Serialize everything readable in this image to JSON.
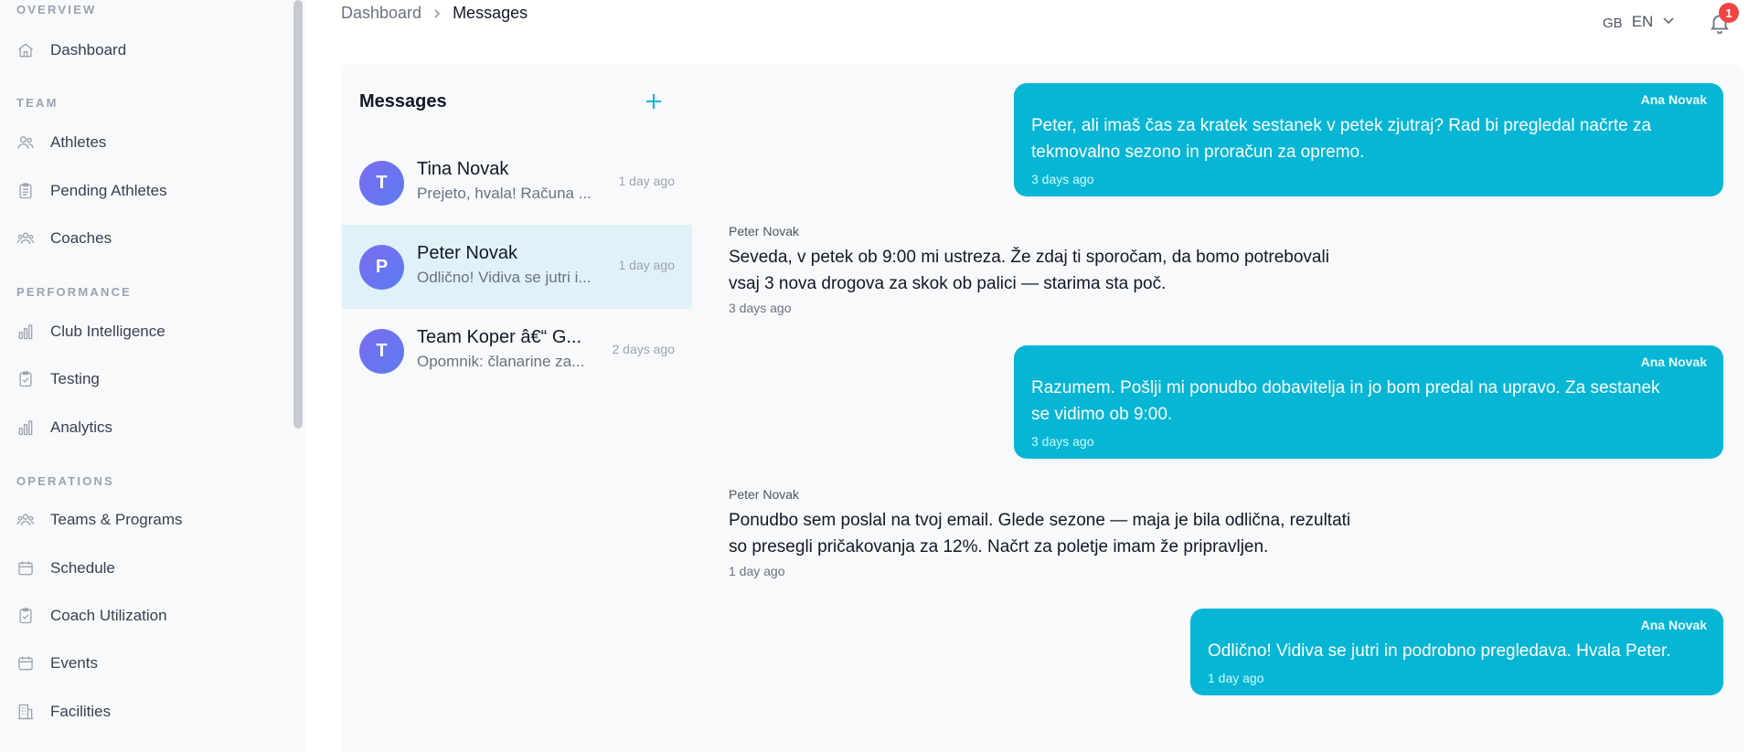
{
  "sidebar": {
    "sections": [
      {
        "title": "OVERVIEW",
        "items": [
          {
            "label": "Dashboard",
            "icon": "home-icon"
          }
        ]
      },
      {
        "title": "TEAM",
        "items": [
          {
            "label": "Athletes",
            "icon": "users-icon"
          },
          {
            "label": "Pending Athletes",
            "icon": "clipboard-icon"
          },
          {
            "label": "Coaches",
            "icon": "users-group-icon"
          }
        ]
      },
      {
        "title": "PERFORMANCE",
        "items": [
          {
            "label": "Club Intelligence",
            "icon": "bar-chart-icon"
          },
          {
            "label": "Testing",
            "icon": "clipboard-check-icon"
          },
          {
            "label": "Analytics",
            "icon": "bar-chart-icon"
          }
        ]
      },
      {
        "title": "OPERATIONS",
        "items": [
          {
            "label": "Teams & Programs",
            "icon": "users-group-icon"
          },
          {
            "label": "Schedule",
            "icon": "calendar-icon"
          },
          {
            "label": "Coach Utilization",
            "icon": "clipboard-check-icon"
          },
          {
            "label": "Events",
            "icon": "calendar-icon"
          },
          {
            "label": "Facilities",
            "icon": "building-icon"
          }
        ]
      }
    ]
  },
  "header": {
    "breadcrumb": {
      "parent": "Dashboard",
      "current": "Messages"
    },
    "language": {
      "flag": "GB",
      "code": "EN"
    },
    "notifications": {
      "count": "1"
    }
  },
  "conversations": {
    "title": "Messages",
    "items": [
      {
        "initial": "T",
        "name": "Tina Novak",
        "preview": "Prejeto, hvala! Računa ...",
        "time": "1 day ago",
        "active": false
      },
      {
        "initial": "P",
        "name": "Peter Novak",
        "preview": "Odlično! Vidiva se jutri i...",
        "time": "1 day ago",
        "active": true
      },
      {
        "initial": "T",
        "name": "Team Koper â€“ G...",
        "preview": "Opomnik: članarine za...",
        "time": "2 days ago",
        "active": false
      }
    ]
  },
  "messages": [
    {
      "direction": "out",
      "sender": "Ana Novak",
      "lines": [
        "Peter, ali imaš čas za kratek sestanek v petek zjutraj? Rad bi pregledal načrte za",
        "tekmovalno sezono in proračun za opremo."
      ],
      "time": "3 days ago"
    },
    {
      "direction": "in",
      "sender": "Peter Novak",
      "lines": [
        "Seveda, v petek ob 9:00 mi ustreza. Že zdaj ti sporočam, da bomo potrebovali",
        "vsaj 3 nova drogova za skok ob palici — starima sta poč."
      ],
      "time": "3 days ago"
    },
    {
      "direction": "out",
      "sender": "Ana Novak",
      "lines": [
        "Razumem. Pošlji mi ponudbo dobavitelja in jo bom predal na upravo. Za sestanek",
        "se vidimo ob 9:00."
      ],
      "time": "3 days ago"
    },
    {
      "direction": "in",
      "sender": "Peter Novak",
      "lines": [
        "Ponudbo sem poslal na tvoj email. Glede sezone — maja je bila odlična, rezultati",
        "so presegli pričakovanja za 12%. Načrt za poletje imam že pripravljen."
      ],
      "time": "1 day ago"
    },
    {
      "direction": "out",
      "sender": "Ana Novak",
      "lines": [
        "Odlično! Vidiva se jutri in podrobno pregledava. Hvala Peter."
      ],
      "time": "1 day ago"
    }
  ]
}
